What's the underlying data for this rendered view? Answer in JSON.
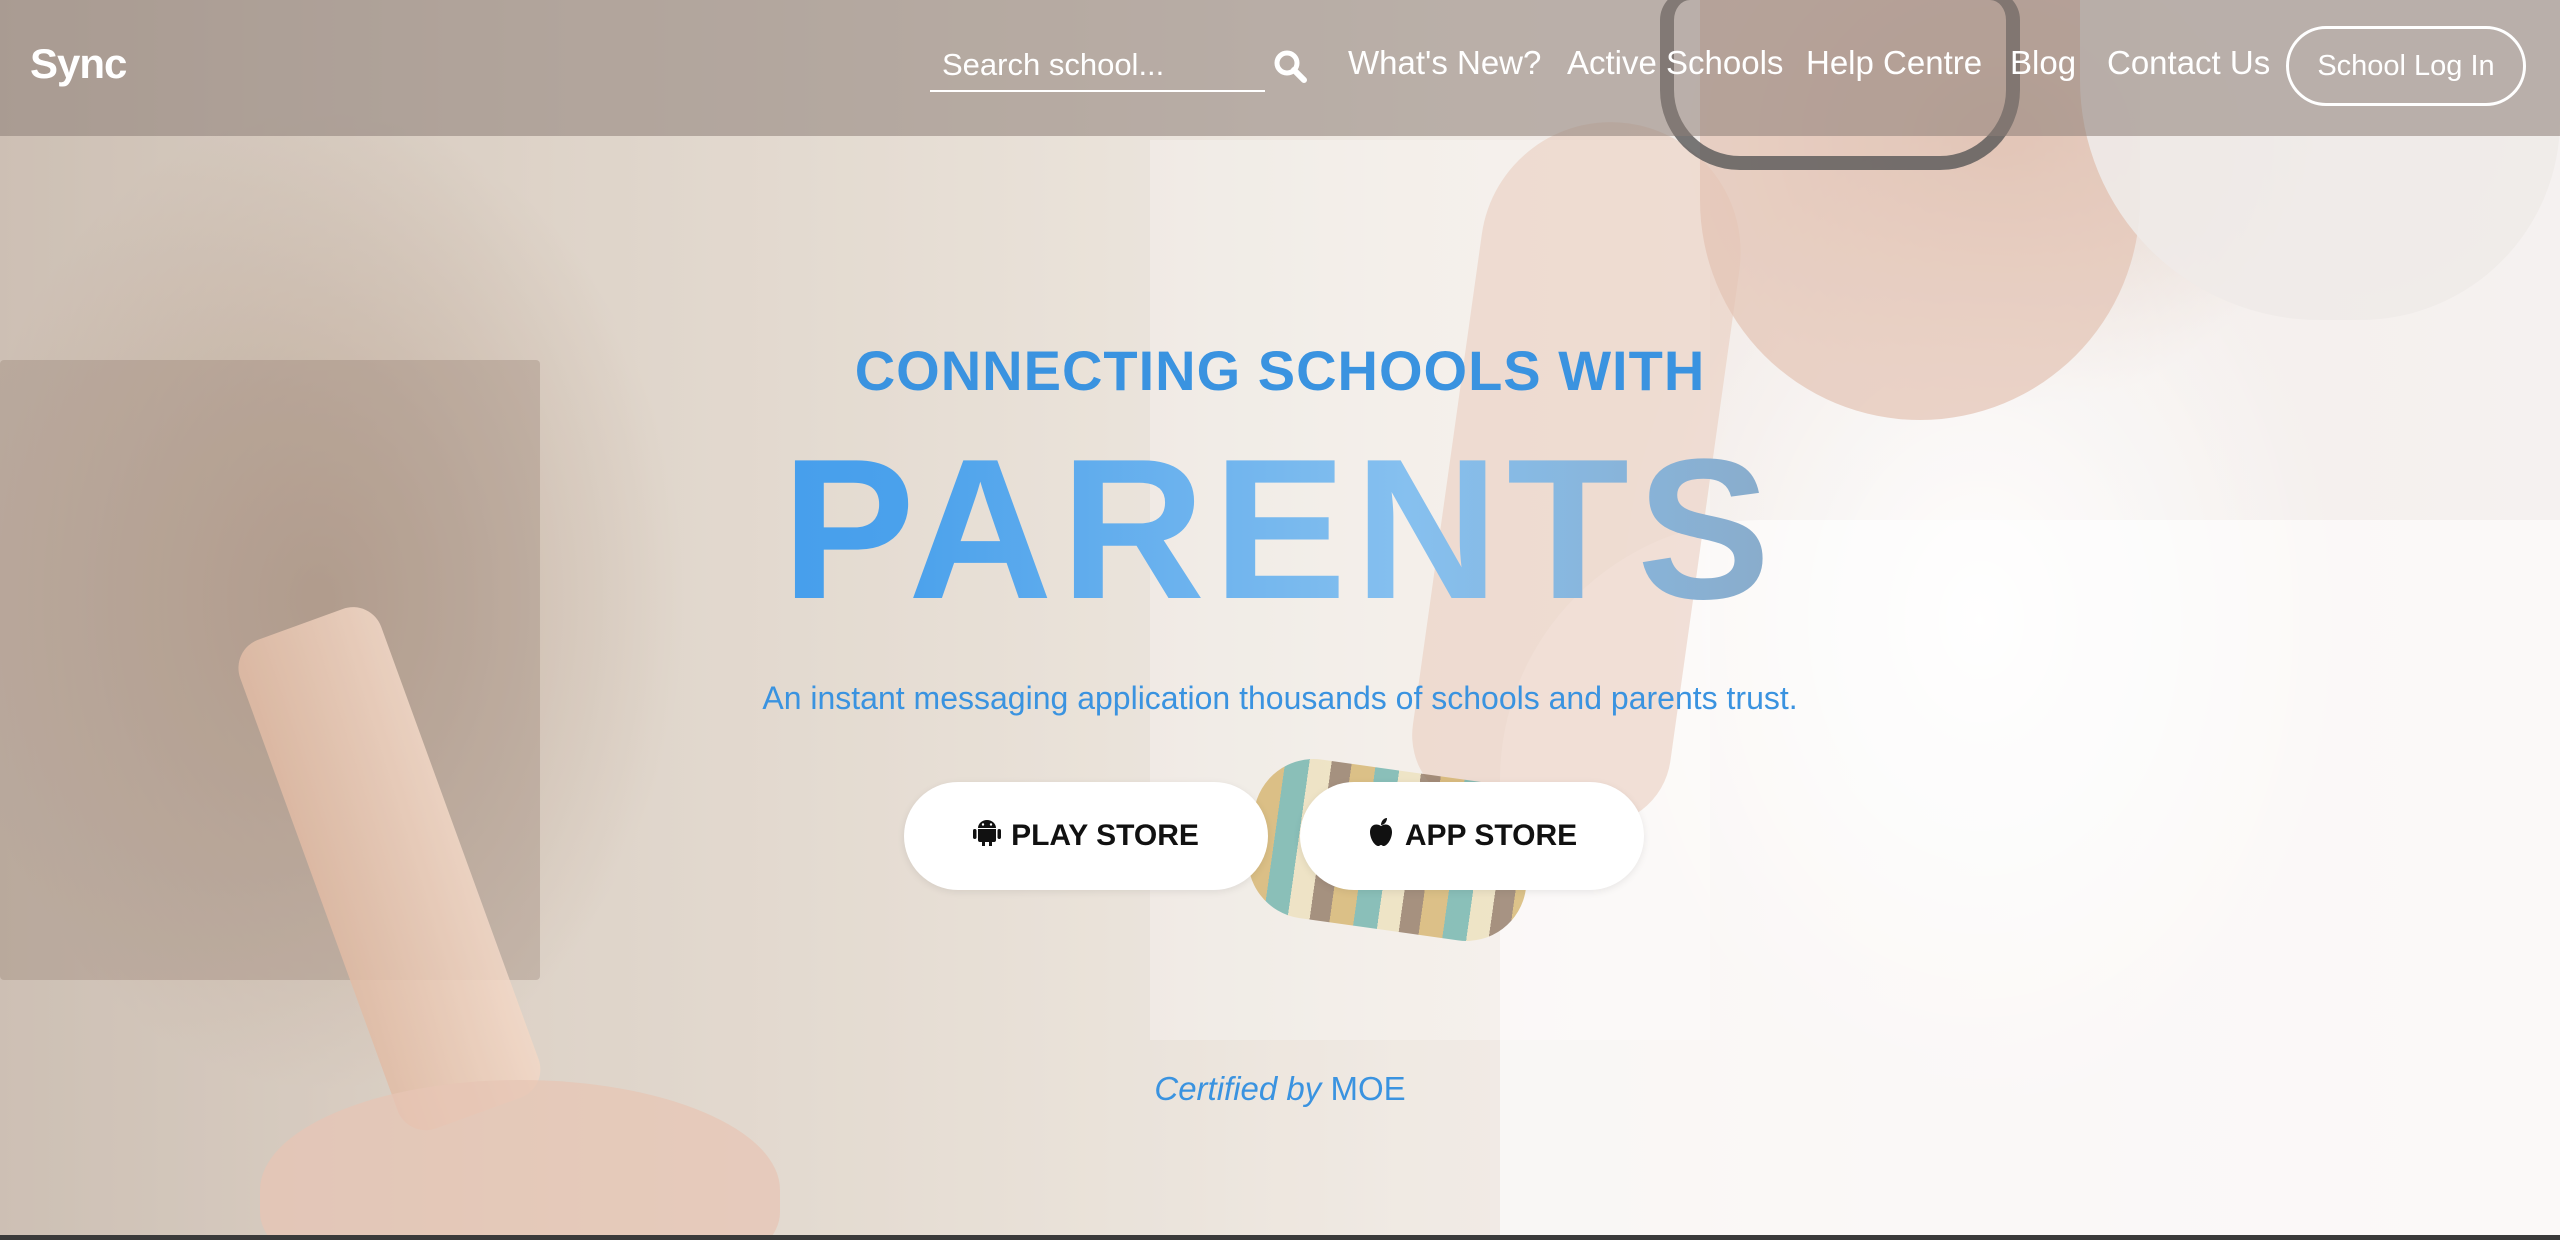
{
  "brand": {
    "name": "Sync"
  },
  "search": {
    "placeholder": "Search school..."
  },
  "nav": {
    "links": [
      {
        "label": "What's New?"
      },
      {
        "label": "Active Schools"
      },
      {
        "label": "Help Centre"
      },
      {
        "label": "Blog"
      },
      {
        "label": "Contact Us"
      }
    ],
    "login_label": "School Log In"
  },
  "hero": {
    "tagline": "CONNECTING SCHOOLS WITH",
    "headline": "PARENTS",
    "subtitle": "An instant messaging application thousands of schools and parents trust.",
    "buttons": {
      "play_store": "PLAY STORE",
      "app_store": "APP STORE"
    },
    "certified_prefix": "Certified by",
    "certified_org": "MOE"
  },
  "colors": {
    "accent": "#3a93e0",
    "nav_text": "#ffffff",
    "button_bg": "#ffffff"
  },
  "icons": {
    "search": "search-icon",
    "android": "android-icon",
    "apple": "apple-icon"
  }
}
